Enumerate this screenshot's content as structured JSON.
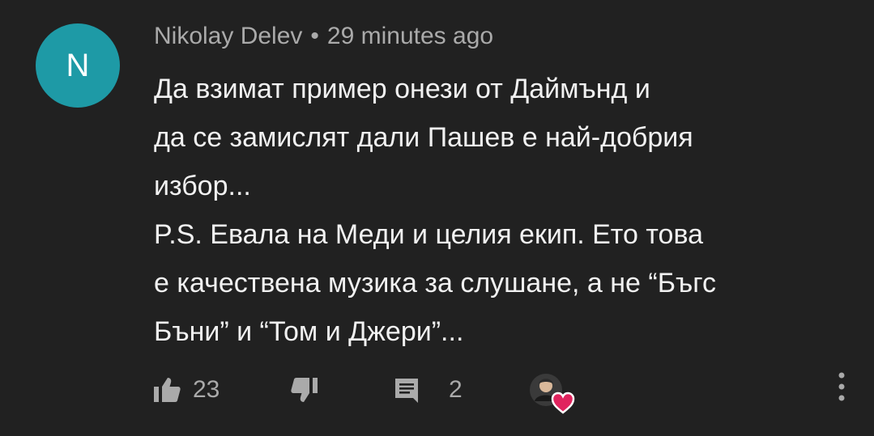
{
  "comment": {
    "avatar_letter": "N",
    "author": "Nikolay Delev",
    "separator": "•",
    "time": "29 minutes ago",
    "text_lines": [
      "Да взимат пример онези от Даймънд и",
      "да се замислят дали Пашев е най-добрия",
      "избор...",
      "P.S. Евала на Меди и целия екип. Ето това",
      "е качествена музика за слушане, а не “Бъгс",
      "Бъни” и “Том и Джери”..."
    ],
    "likes": "23",
    "replies": "2"
  },
  "icons": {
    "like": "thumbs-up-icon",
    "dislike": "thumbs-down-icon",
    "reply": "comment-icon",
    "creator_heart": "heart-icon",
    "more": "more-vertical-icon"
  },
  "colors": {
    "background": "#212121",
    "avatar": "#1e9aa6",
    "heart": "#e0245e",
    "text": "#f1f1f1",
    "secondary_text": "#aaaaaa"
  }
}
